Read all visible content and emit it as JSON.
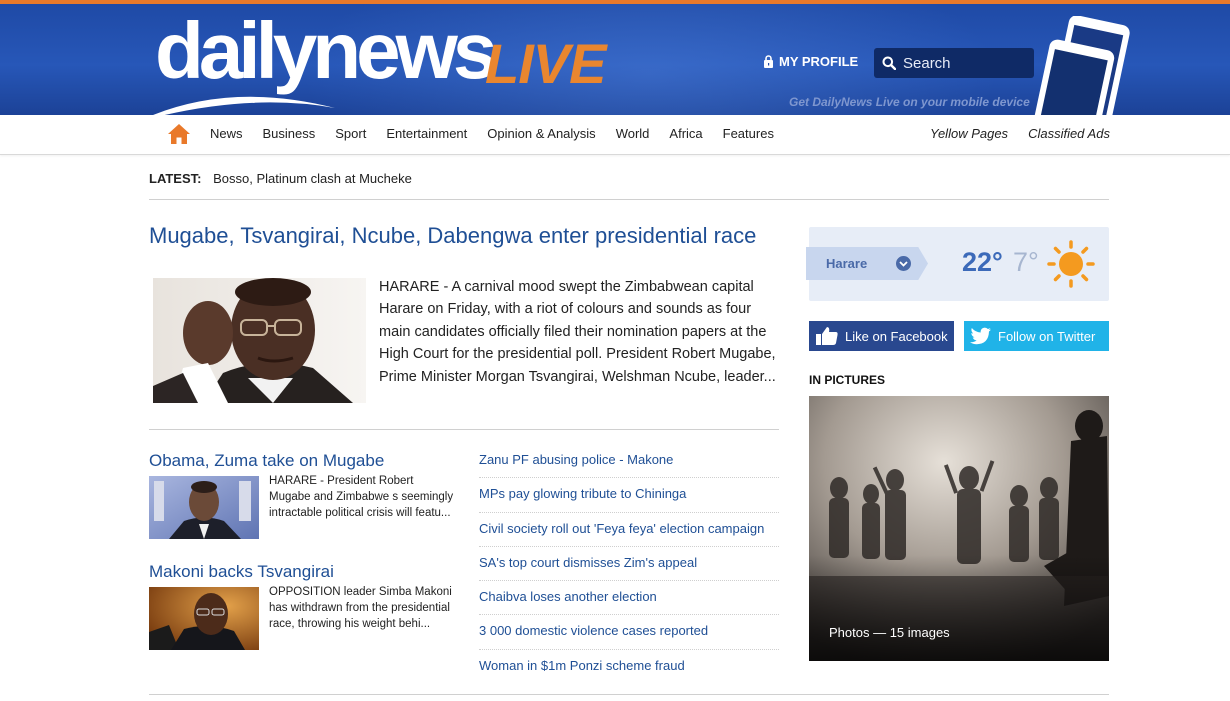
{
  "header": {
    "logo_main": "dailynews",
    "logo_accent": "LIVE",
    "my_profile_label": "MY PROFILE",
    "search_placeholder": "Search",
    "mobile_tagline": "Get DailyNews Live on your mobile device",
    "colors": {
      "brand_blue": "#2757b8",
      "accent_orange": "#e9862f"
    }
  },
  "nav": {
    "home_icon": "home-icon",
    "items": [
      "News",
      "Business",
      "Sport",
      "Entertainment",
      "Opinion & Analysis",
      "World",
      "Africa",
      "Features"
    ],
    "right_items": [
      "Yellow Pages",
      "Classified Ads"
    ]
  },
  "latest": {
    "label": "LATEST:",
    "headline": "Bosso, Platinum clash at Mucheke"
  },
  "lead_story": {
    "title": "Mugabe, Tsvangirai, Ncube, Dabengwa enter presidential race",
    "excerpt": "HARARE - A carnival mood swept the Zimbabwean capital Harare on Friday, with a riot of colours and sounds as four main candidates officially filed their nomination papers at the High Court for the presidential poll. President Robert Mugabe, Prime Minister Morgan Tsvangirai, Welshman Ncube, leader..."
  },
  "stories": [
    {
      "title": "Obama, Zuma take on Mugabe",
      "excerpt": "HARARE - President Robert Mugabe and Zimbabwe s seemingly intractable political crisis will featu..."
    },
    {
      "title": "Makoni backs Tsvangirai",
      "excerpt": "OPPOSITION leader Simba Makoni has withdrawn from the presidential race, throwing his weight behi..."
    }
  ],
  "headlines": [
    "Zanu PF abusing police - Makone",
    "MPs pay glowing tribute to Chininga",
    "Civil society roll out 'Feya feya' election campaign",
    "SA's top court dismisses Zim's appeal",
    "Chaibva loses another election",
    "3 000 domestic violence cases reported",
    "Woman in $1m Ponzi scheme fraud"
  ],
  "weather": {
    "city": "Harare",
    "high": "22°",
    "low": "7°",
    "icon": "sun-icon"
  },
  "social": {
    "facebook_label": "Like on Facebook",
    "twitter_label": "Follow on Twitter"
  },
  "in_pictures": {
    "label": "IN PICTURES",
    "caption": "Photos — 15 images"
  }
}
